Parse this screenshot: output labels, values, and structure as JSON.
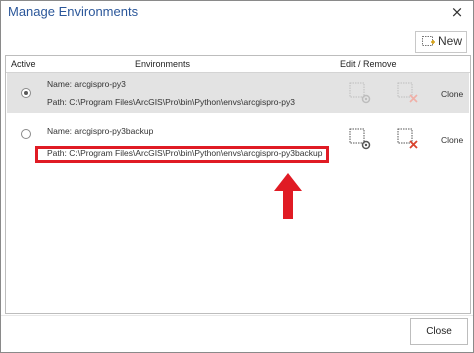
{
  "window": {
    "title": "Manage Environments",
    "close_glyph": "×"
  },
  "toolbar": {
    "new_label": "New",
    "new_icon": "new-environment-icon"
  },
  "table": {
    "headers": {
      "active": "Active",
      "environments": "Environments",
      "edit_remove": "Edit / Remove"
    },
    "rows": [
      {
        "active": true,
        "name": "Name: arcgispro-py3",
        "path": "Path: C:\\Program Files\\ArcGIS\\Pro\\bin\\Python\\envs\\arcgispro-py3",
        "clone_label": "Clone"
      },
      {
        "active": false,
        "name": "Name: arcgispro-py3backup",
        "path": "Path: C:\\Program Files\\ArcGIS\\Pro\\bin\\Python\\envs\\arcgispro-py3backup",
        "clone_label": "Clone"
      }
    ]
  },
  "annotation": {
    "highlight_color": "#e01b24"
  },
  "footer": {
    "close_label": "Close"
  },
  "colors": {
    "title": "#2b579a",
    "selected_row": "#e3e3e3"
  }
}
